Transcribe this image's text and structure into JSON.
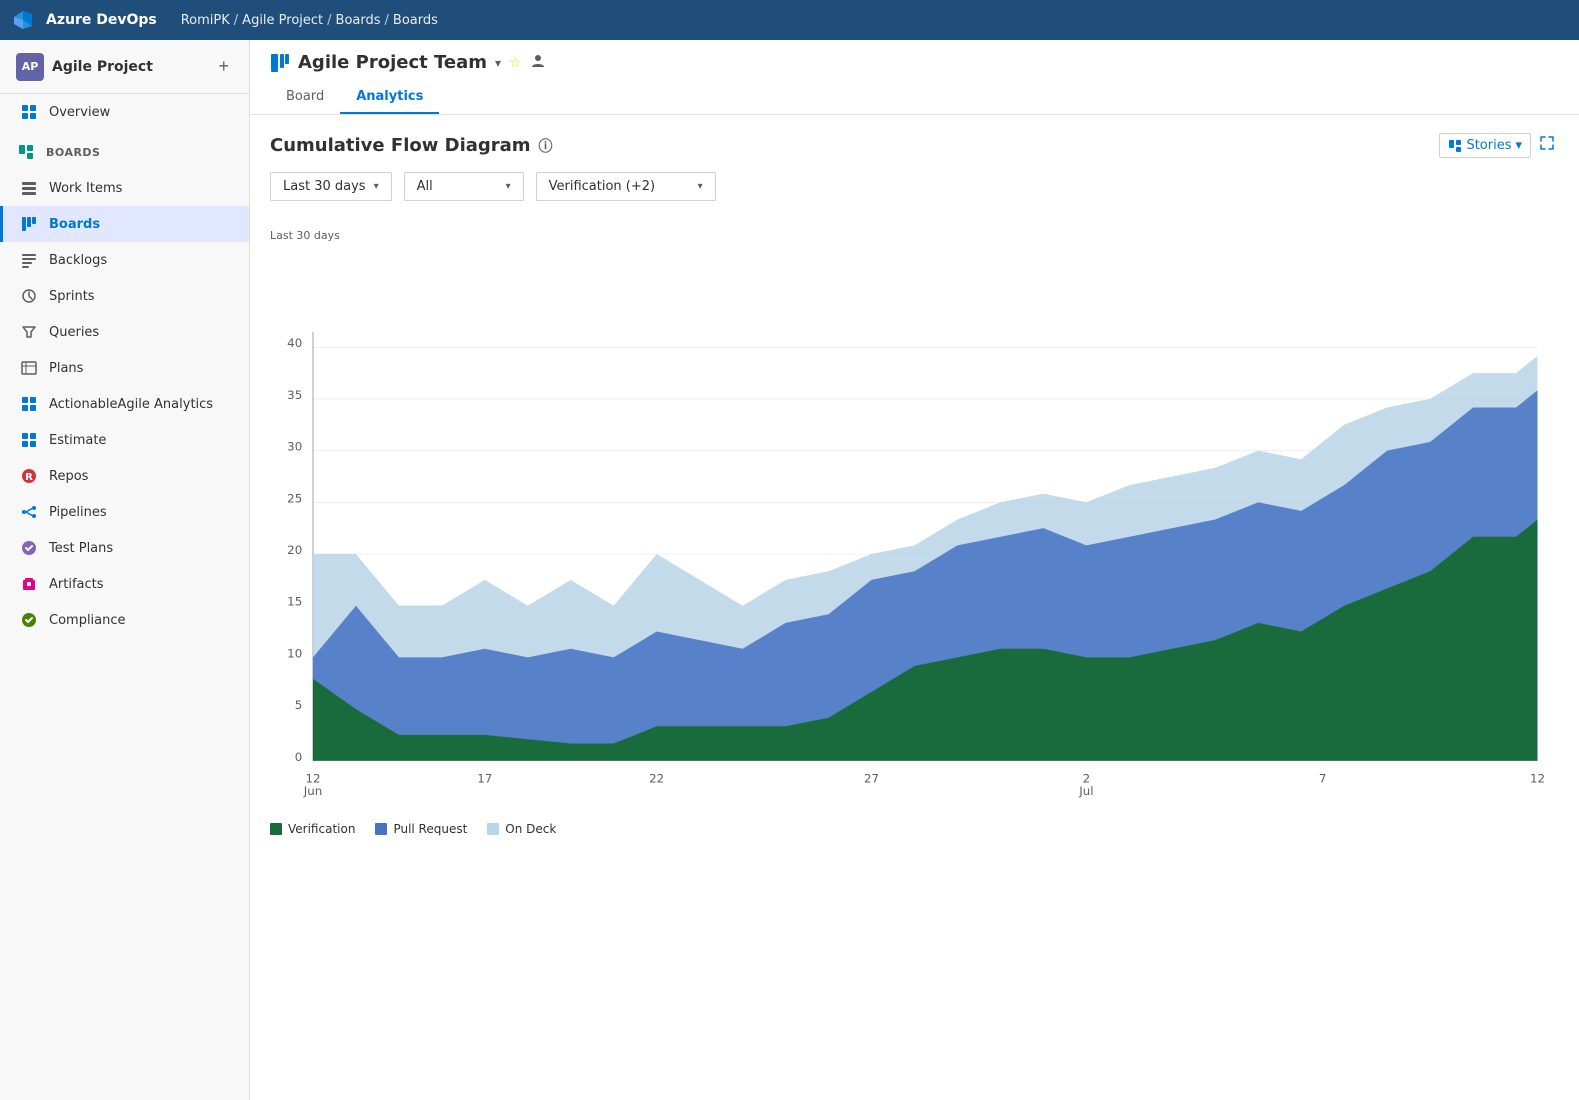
{
  "topbar": {
    "logo_text": "Azure DevOps",
    "breadcrumb": [
      "RomiPK",
      "Agile Project",
      "Boards",
      "Boards"
    ]
  },
  "sidebar": {
    "project_initials": "AP",
    "project_name": "Agile Project",
    "add_label": "+",
    "items": [
      {
        "id": "overview",
        "label": "Overview",
        "icon": "overview"
      },
      {
        "id": "boards-section",
        "label": "Boards",
        "icon": "boards-section"
      },
      {
        "id": "work-items",
        "label": "Work Items",
        "icon": "work-items"
      },
      {
        "id": "boards",
        "label": "Boards",
        "icon": "boards",
        "active": true
      },
      {
        "id": "backlogs",
        "label": "Backlogs",
        "icon": "backlogs"
      },
      {
        "id": "sprints",
        "label": "Sprints",
        "icon": "sprints"
      },
      {
        "id": "queries",
        "label": "Queries",
        "icon": "queries"
      },
      {
        "id": "plans",
        "label": "Plans",
        "icon": "plans"
      },
      {
        "id": "actionable",
        "label": "ActionableAgile Analytics",
        "icon": "actionable"
      },
      {
        "id": "estimate",
        "label": "Estimate",
        "icon": "estimate"
      },
      {
        "id": "repos",
        "label": "Repos",
        "icon": "repos"
      },
      {
        "id": "pipelines",
        "label": "Pipelines",
        "icon": "pipelines"
      },
      {
        "id": "test-plans",
        "label": "Test Plans",
        "icon": "test-plans"
      },
      {
        "id": "artifacts",
        "label": "Artifacts",
        "icon": "artifacts"
      },
      {
        "id": "compliance",
        "label": "Compliance",
        "icon": "compliance"
      }
    ]
  },
  "page": {
    "team_name": "Agile Project Team",
    "tabs": [
      {
        "id": "board",
        "label": "Board"
      },
      {
        "id": "analytics",
        "label": "Analytics",
        "active": true
      }
    ],
    "stories_label": "Stories",
    "chart_title": "Cumulative Flow Diagram",
    "date_range_label": "Last 30 days",
    "filter_all_label": "All",
    "filter_verification_label": "Verification (+2)",
    "chart_date_label": "Last 30 days",
    "x_labels": [
      "12\nJun",
      "17",
      "22",
      "27",
      "2\nJul",
      "7",
      "12"
    ],
    "y_labels": [
      "0",
      "5",
      "10",
      "15",
      "20",
      "25",
      "30",
      "35",
      "40"
    ],
    "legend": [
      {
        "label": "Verification",
        "color": "#1a6b3c"
      },
      {
        "label": "Pull Request",
        "color": "#4472c4"
      },
      {
        "label": "On Deck",
        "color": "#b8d4e8"
      }
    ]
  }
}
